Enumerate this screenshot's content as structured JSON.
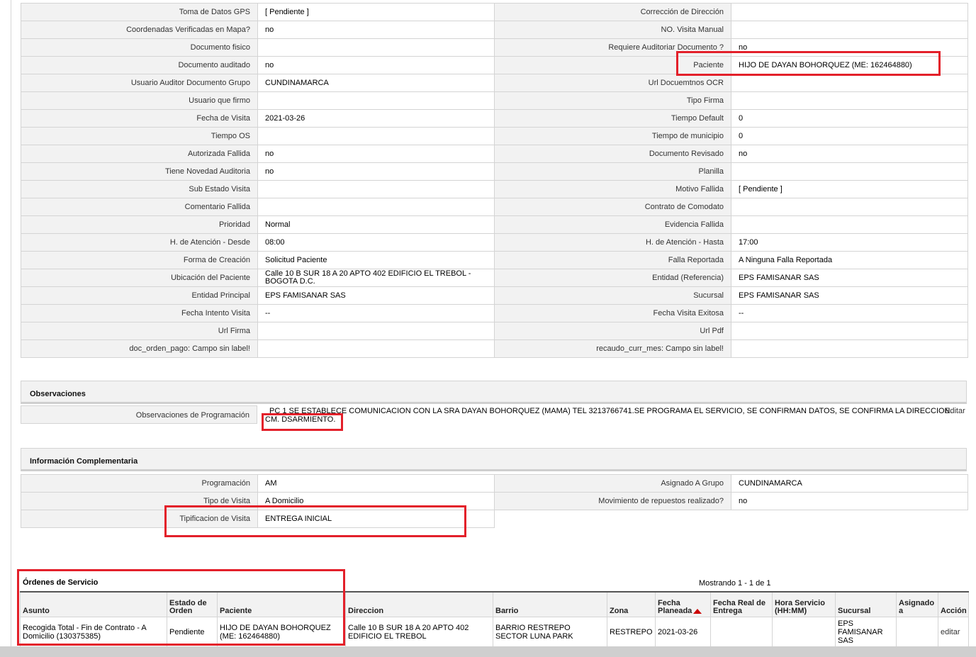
{
  "details": {
    "rows": [
      {
        "l1": "Toma de Datos GPS",
        "v1": "[ Pendiente ]",
        "l2": "Corrección de Dirección",
        "v2": ""
      },
      {
        "l1": "Coordenadas Verificadas en Mapa?",
        "v1": " no",
        "l2": "NO. Visita Manual",
        "v2": ""
      },
      {
        "l1": "Documento fisico",
        "v1": "",
        "l2": "Requiere Auditoriar Documento ?",
        "v2": " no"
      },
      {
        "l1": "Documento auditado",
        "v1": " no",
        "l2": "Paciente",
        "v2": "HIJO DE DAYAN BOHORQUEZ (ME: 162464880)"
      },
      {
        "l1": "Usuario Auditor Documento Grupo",
        "v1": "CUNDINAMARCA",
        "l2": "Url Docuemtnos OCR",
        "v2": ""
      },
      {
        "l1": "Usuario que firmo",
        "v1": "",
        "l2": "Tipo Firma",
        "v2": ""
      },
      {
        "l1": "Fecha de Visita",
        "v1": " 2021-03-26",
        "l2": "Tiempo Default",
        "v2": "0"
      },
      {
        "l1": "Tiempo OS",
        "v1": "",
        "l2": "Tiempo de municipio",
        "v2": "0"
      },
      {
        "l1": "Autorizada Fallida",
        "v1": " no",
        "l2": "Documento Revisado",
        "v2": " no"
      },
      {
        "l1": "Tiene Novedad Auditoria",
        "v1": " no",
        "l2": "Planilla",
        "v2": ""
      },
      {
        "l1": "Sub Estado Visita",
        "v1": "",
        "l2": "Motivo Fallida",
        "v2": "[ Pendiente ]"
      },
      {
        "l1": "Comentario Fallida",
        "v1": "",
        "l2": "Contrato de Comodato",
        "v2": ""
      },
      {
        "l1": "Prioridad",
        "v1": "Normal",
        "l2": "Evidencia Fallida",
        "v2": ""
      },
      {
        "l1": "H. de Atención - Desde",
        "v1": "08:00",
        "l2": "H. de Atención - Hasta",
        "v2": "17:00"
      },
      {
        "l1": "Forma de Creación",
        "v1": "Solicitud Paciente",
        "l2": "Falla Reportada",
        "v2": "A Ninguna Falla Reportada"
      },
      {
        "l1": "Ubicación del Paciente",
        "v1": "Calle 10 B SUR 18 A 20 APTO 402 EDIFICIO EL TREBOL - BOGOTA D.C.",
        "l2": "Entidad (Referencia)",
        "v2": "EPS FAMISANAR SAS"
      },
      {
        "l1": "Entidad Principal",
        "v1": "EPS FAMISANAR SAS",
        "l2": "Sucursal",
        "v2": "EPS FAMISANAR SAS"
      },
      {
        "l1": "Fecha Intento Visita",
        "v1": " --",
        "l2": "Fecha Visita Exitosa",
        "v2": " --"
      },
      {
        "l1": "Url Firma",
        "v1": "",
        "l2": "Url Pdf",
        "v2": ""
      },
      {
        "l1": "doc_orden_pago: Campo sin label!",
        "v1": "",
        "l2": "recaudo_curr_mes: Campo sin label!",
        "v2": ""
      }
    ]
  },
  "observaciones": {
    "title": "Observaciones",
    "label": "Observaciones de Programación",
    "value": "PC 1 SE ESTABLECE COMUNICACION CON LA SRA DAYAN BOHORQUEZ (MAMA) TEL 3213766741.SE PROGRAMA EL SERVICIO, SE CONFIRMAN DATOS, SE CONFIRMA LA DIRECCION. CM. DSARMIENTO.",
    "edit": "Editar"
  },
  "complementaria": {
    "title": "Información Complementaria",
    "rows": [
      {
        "l1": "Programación",
        "v1": "AM",
        "l2": "Asignado A Grupo",
        "v2": "CUNDINAMARCA"
      },
      {
        "l1": "Tipo de Visita",
        "v1": "A Domicilio",
        "l2": "Movimiento de repuestos realizado?",
        "v2": " no"
      }
    ],
    "tipificacion_label": "Tipificacion de Visita",
    "tipificacion_value": "ENTREGA INICIAL"
  },
  "ordenes": {
    "title": "Órdenes de Servicio",
    "count": "Mostrando 1 - 1 de 1",
    "headers": {
      "asunto": "Asunto",
      "estado": "Estado de Orden",
      "paciente": "Paciente",
      "direccion": "Direccion",
      "barrio": "Barrio",
      "zona": "Zona",
      "fecha_planeada": "Fecha Planeada",
      "fecha_real": "Fecha Real de Entrega",
      "hora": "Hora Servicio (HH:MM)",
      "sucursal": "Sucursal",
      "asignado": "Asignado a",
      "accion": "Acción"
    },
    "row": {
      "asunto": "Recogida Total - Fin de Contrato - A Domicilio (130375385)",
      "estado": "Pendiente",
      "paciente": "HIJO DE DAYAN BOHORQUEZ (ME: 162464880)",
      "direccion": "Calle 10 B SUR 18 A 20 APTO 402 EDIFICIO EL TREBOL",
      "barrio": "BARRIO RESTREPO SECTOR LUNA PARK",
      "zona": "RESTREPO",
      "fecha_planeada": "2021-03-26",
      "fecha_real": "",
      "hora": "",
      "sucursal": "EPS FAMISANAR SAS",
      "asignado": "",
      "accion": "editar"
    }
  },
  "colors": {
    "highlight": "#e3202a",
    "header_bg": "#f2f2f2",
    "border": "#d4d4d4",
    "sort_arrow": "#cc0000"
  }
}
